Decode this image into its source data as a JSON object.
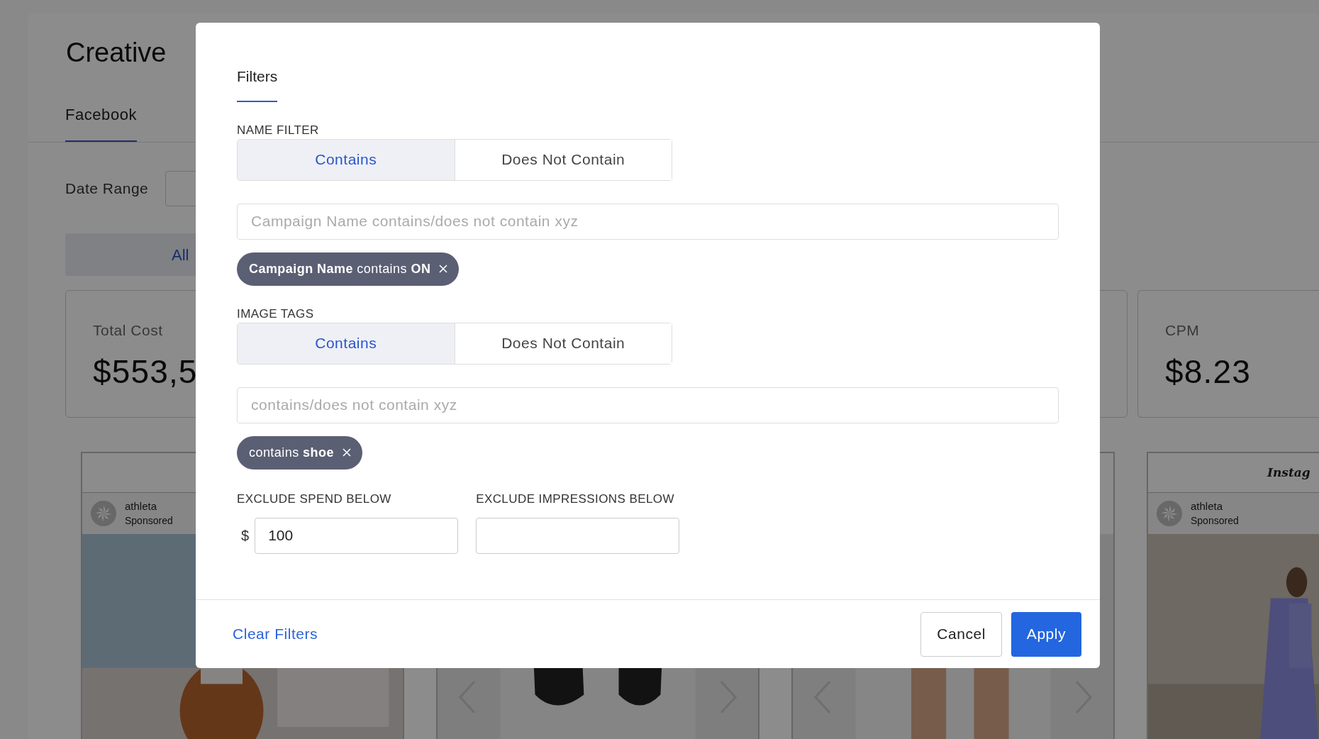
{
  "page": {
    "title": "Creative",
    "tabs": [
      {
        "label": "Facebook",
        "selected": true
      }
    ],
    "date_range_label": "Date Range",
    "segment": {
      "label": "All",
      "selected": true
    },
    "stats": [
      {
        "label": "Total Cost",
        "value": "$553,5"
      },
      {
        "label": "CPM",
        "value": "$8.23"
      }
    ],
    "creatives": [
      {
        "kind": "post",
        "account": "athleta",
        "subtitle": "Sponsored"
      },
      {
        "kind": "carousel"
      },
      {
        "kind": "carousel"
      },
      {
        "kind": "post",
        "logo": "Instag",
        "account": "athleta",
        "subtitle": "Sponsored"
      }
    ]
  },
  "modal": {
    "tabs": [
      {
        "label": "Filters",
        "selected": true
      }
    ],
    "sections": [
      {
        "label": "NAME FILTER",
        "options": [
          {
            "label": "Contains",
            "selected": true
          },
          {
            "label": "Does Not Contain",
            "selected": false
          }
        ],
        "placeholder": "Campaign Name contains/does not contain xyz",
        "chips": [
          "**Campaign Name** contains **ON**"
        ]
      },
      {
        "label": "IMAGE TAGS",
        "options": [
          {
            "label": "Contains",
            "selected": true
          },
          {
            "label": "Does Not Contain",
            "selected": false
          }
        ],
        "placeholder": "contains/does not contain xyz",
        "chips": [
          "contains **shoe**"
        ]
      }
    ],
    "excludes": [
      {
        "label": "EXCLUDE SPEND BELOW",
        "prefix": "$",
        "value": "100"
      },
      {
        "label": "EXCLUDE IMPRESSIONS BELOW"
      }
    ],
    "clear": "Clear Filters",
    "cancel": "Cancel",
    "apply": "Apply"
  }
}
